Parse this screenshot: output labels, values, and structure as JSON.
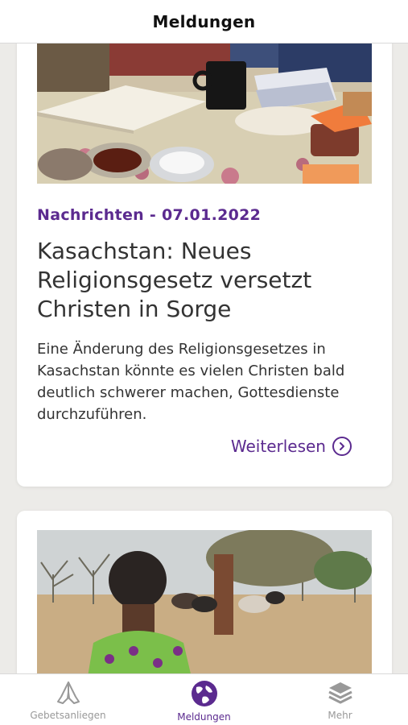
{
  "header": {
    "title": "Meldungen"
  },
  "articles": [
    {
      "category_date": "Nachrichten - 07.01.2022",
      "title": "Kasachstan: Neues Religionsgesetz versetzt Christen in Sorge",
      "excerpt": "Eine Änderung des Religionsgesetzes in Kasachstan könnte es vielen Christen bald deutlich schwerer machen, Gottesdienste durchzuführen.",
      "read_more": "Weiterlesen"
    }
  ],
  "tabbar": {
    "items": [
      {
        "label": "Gebetsanliegen",
        "icon": "praying-hands-icon",
        "active": false
      },
      {
        "label": "Meldungen",
        "icon": "globe-icon",
        "active": true
      },
      {
        "label": "Mehr",
        "icon": "layers-icon",
        "active": false
      }
    ]
  },
  "colors": {
    "accent": "#5b2a8f",
    "background": "#ecebe8",
    "inactive": "#999999"
  }
}
